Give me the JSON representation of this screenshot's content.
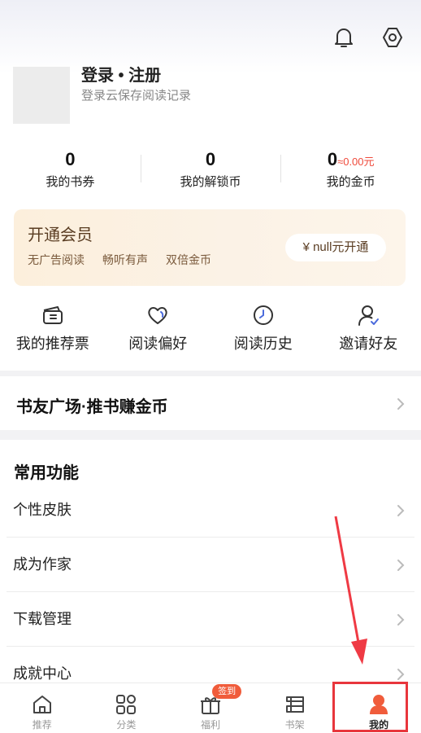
{
  "header": {
    "icons": [
      "bell-icon",
      "settings-icon"
    ]
  },
  "profile": {
    "login_title": "登录 • 注册",
    "login_subtitle": "登录云保存阅读记录"
  },
  "stats": [
    {
      "value": "0",
      "label": "我的书券",
      "extra": ""
    },
    {
      "value": "0",
      "label": "我的解锁币",
      "extra": ""
    },
    {
      "value": "0",
      "label": "我的金币",
      "extra": "≈0.00元"
    }
  ],
  "vip": {
    "title": "开通会员",
    "perks": [
      "无广告阅读",
      "畅听有声",
      "双倍金币"
    ],
    "button": "¥ null元开通"
  },
  "quick_actions": [
    {
      "label": "我的推荐票",
      "icon": "ticket-icon"
    },
    {
      "label": "阅读偏好",
      "icon": "heart-icon"
    },
    {
      "label": "阅读历史",
      "icon": "history-clock-icon"
    },
    {
      "label": "邀请好友",
      "icon": "invite-user-icon"
    }
  ],
  "book_square": {
    "label": "书友广场·推书赚金币"
  },
  "common": {
    "title": "常用功能",
    "items": [
      "个性皮肤",
      "成为作家",
      "下载管理",
      "成就中心"
    ]
  },
  "tabbar": {
    "tabs": [
      {
        "label": "推荐",
        "icon": "home-icon"
      },
      {
        "label": "分类",
        "icon": "category-grid-icon"
      },
      {
        "label": "福利",
        "icon": "gift-icon",
        "badge": "签到"
      },
      {
        "label": "书架",
        "icon": "bookshelf-icon"
      },
      {
        "label": "我的",
        "icon": "profile-icon"
      }
    ],
    "active": "我的"
  },
  "colors": {
    "accent": "#f05c3b",
    "coin_note": "#ef4a3b",
    "vip_text": "#5a3d22",
    "highlight": "#e8363c"
  }
}
